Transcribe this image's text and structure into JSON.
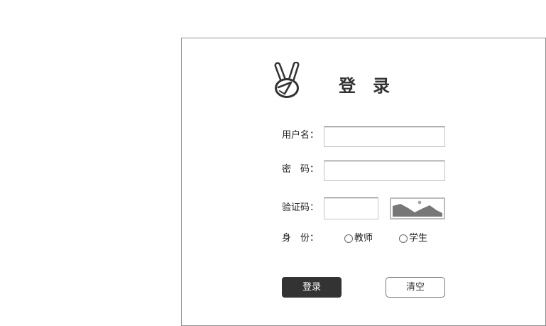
{
  "login": {
    "logo_icon": "victory-hand-icon",
    "title": "登　录",
    "fields": {
      "username": {
        "label": "用户名：",
        "value": ""
      },
      "password": {
        "label": "密　码：",
        "value": ""
      },
      "captcha": {
        "label": "验证码：",
        "value": "",
        "image_icon": "image-placeholder-icon"
      }
    },
    "role": {
      "label": "身　份：",
      "options": [
        {
          "label": "教师",
          "checked": false
        },
        {
          "label": "学生",
          "checked": false
        }
      ]
    },
    "buttons": {
      "login": "登录",
      "clear": "清空"
    }
  },
  "colors": {
    "primary_button": "#333333",
    "text": "#333333",
    "border": "#8f8f8f"
  }
}
